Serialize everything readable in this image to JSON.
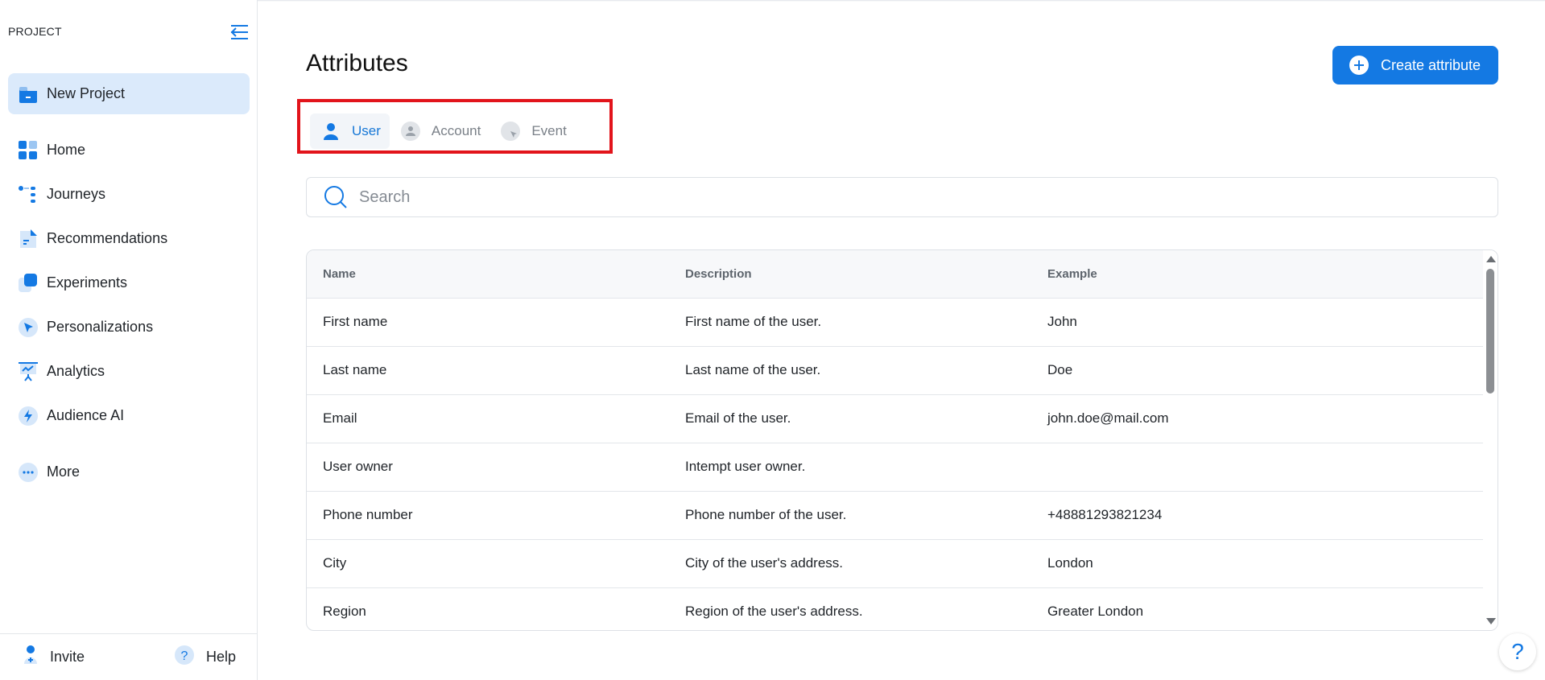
{
  "sidebar": {
    "project_label": "PROJECT",
    "current_project": "New Project",
    "items": [
      {
        "label": "Home",
        "icon": "home-icon"
      },
      {
        "label": "Journeys",
        "icon": "journeys-icon"
      },
      {
        "label": "Recommendations",
        "icon": "recommendations-icon"
      },
      {
        "label": "Experiments",
        "icon": "experiments-icon"
      },
      {
        "label": "Personalizations",
        "icon": "personalizations-icon"
      },
      {
        "label": "Analytics",
        "icon": "analytics-icon"
      },
      {
        "label": "Audience AI",
        "icon": "audience-ai-icon"
      }
    ],
    "more_label": "More",
    "footer": {
      "invite_label": "Invite",
      "help_label": "Help"
    }
  },
  "main": {
    "title": "Attributes",
    "create_button_label": "Create attribute",
    "tabs": [
      {
        "label": "User",
        "active": true
      },
      {
        "label": "Account",
        "active": false
      },
      {
        "label": "Event",
        "active": false
      }
    ],
    "search": {
      "placeholder": "Search",
      "value": ""
    },
    "table": {
      "columns": [
        "Name",
        "Description",
        "Example"
      ],
      "rows": [
        [
          "First name",
          "First name of the user.",
          "John"
        ],
        [
          "Last name",
          "Last name of the user.",
          "Doe"
        ],
        [
          "Email",
          "Email of the user.",
          "john.doe@mail.com"
        ],
        [
          "User owner",
          "Intempt user owner.",
          ""
        ],
        [
          "Phone number",
          "Phone number of the user.",
          "+48881293821234"
        ],
        [
          "City",
          "City of the user's address.",
          "London"
        ],
        [
          "Region",
          "Region of the user's address.",
          "Greater London"
        ]
      ]
    },
    "help_fab_label": "?"
  },
  "colors": {
    "accent": "#1479e3",
    "highlight_box": "#e2141b",
    "project_card_bg": "#dbeafb"
  }
}
